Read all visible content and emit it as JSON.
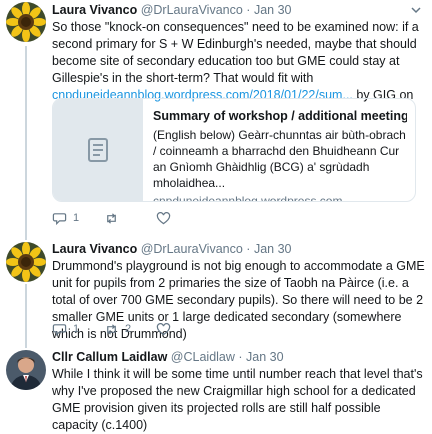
{
  "tweets": [
    {
      "name": "Laura Vivanco",
      "handle": "@DrLauraVivanco",
      "separator": "·",
      "date": "Jan 30",
      "text_before_link": "So those \"knock-on consequences\" need to be examined now: if a second primary for S + W Edinburgh's needed, maybe that should become site of secondary education too but GME could stay at Gillespie's in the short-term? That would fit with ",
      "link": "cnpduneideannblog.wordpress.com/2018/01/22/sum...",
      "text_after_link": " by GIG on 22 Jan.",
      "card": {
        "title": "Summary of workshop / additional meeting of G...",
        "description": "(English below) Geàrr-chunntas air bùth-obrach / coinneamh a bharrachd den Bhuidheann Cur an Gnìomh Ghàidhlig (BCG) a' sgrùdadh mholaidhea...",
        "domain": "cnpduneideannblog.wordpress.com",
        "thumb_icon": "document-icon"
      },
      "actions": {
        "reply_count": "1",
        "retweet_count": "",
        "like_count": ""
      }
    },
    {
      "name": "Laura Vivanco",
      "handle": "@DrLauraVivanco",
      "separator": "·",
      "date": "Jan 30",
      "text": "Drummond's playground is not big enough to accommodate a GME unit for pupils from 2 primaries the size of Taobh na Pàirce (i.e. a total of over 700 GME secondary pupils). So there will need to be 2 smaller GME units or 1 large dedicated secondary (somewhere which is not Drummond)",
      "actions": {
        "reply_count": "1",
        "retweet_count": "2",
        "like_count": ""
      }
    },
    {
      "name": "Cllr Callum Laidlaw",
      "handle": "@CLaidlaw",
      "separator": "·",
      "date": "Jan 30",
      "text": "While I think it will be some time until number reach that level that's why I've proposed the new Craigmillar high school for a dedicated GME provision given its projected rolls are still half possible capacity (c.1400)"
    }
  ],
  "colors": {
    "text": "#14171a",
    "muted": "#657786",
    "link": "#1b95e0",
    "thread_line": "#ccd6dd",
    "card_border": "#e1e8ed"
  }
}
